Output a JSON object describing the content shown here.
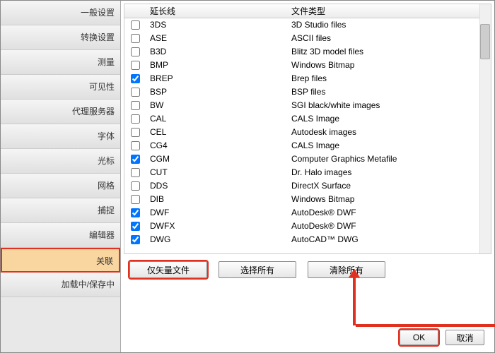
{
  "sidebar": {
    "items": [
      {
        "label": "一般设置"
      },
      {
        "label": "转换设置"
      },
      {
        "label": "测量"
      },
      {
        "label": "可见性"
      },
      {
        "label": "代理服务器"
      },
      {
        "label": "字体"
      },
      {
        "label": "光标"
      },
      {
        "label": "网格"
      },
      {
        "label": "捕捉"
      },
      {
        "label": "编辑器"
      },
      {
        "label": "关联"
      },
      {
        "label": "加载中/保存中"
      }
    ],
    "selected_index": 10
  },
  "table": {
    "headers": {
      "ext": "延长线",
      "type": "文件类型"
    },
    "rows": [
      {
        "checked": false,
        "ext": "3DS",
        "type": "3D Studio files"
      },
      {
        "checked": false,
        "ext": "ASE",
        "type": "ASCII files"
      },
      {
        "checked": false,
        "ext": "B3D",
        "type": "Blitz 3D model files"
      },
      {
        "checked": false,
        "ext": "BMP",
        "type": "Windows Bitmap"
      },
      {
        "checked": true,
        "ext": "BREP",
        "type": "Brep files"
      },
      {
        "checked": false,
        "ext": "BSP",
        "type": "BSP files"
      },
      {
        "checked": false,
        "ext": "BW",
        "type": "SGI black/white images"
      },
      {
        "checked": false,
        "ext": "CAL",
        "type": "CALS Image"
      },
      {
        "checked": false,
        "ext": "CEL",
        "type": "Autodesk images"
      },
      {
        "checked": false,
        "ext": "CG4",
        "type": "CALS Image"
      },
      {
        "checked": true,
        "ext": "CGM",
        "type": "Computer Graphics Metafile"
      },
      {
        "checked": false,
        "ext": "CUT",
        "type": "Dr. Halo images"
      },
      {
        "checked": false,
        "ext": "DDS",
        "type": "DirectX Surface"
      },
      {
        "checked": false,
        "ext": "DIB",
        "type": "Windows Bitmap"
      },
      {
        "checked": true,
        "ext": "DWF",
        "type": "AutoDesk® DWF"
      },
      {
        "checked": true,
        "ext": "DWFX",
        "type": "AutoDesk® DWF"
      },
      {
        "checked": true,
        "ext": "DWG",
        "type": "AutoCAD™ DWG"
      }
    ]
  },
  "buttons": {
    "vector_only": "仅矢量文件",
    "select_all": "选择所有",
    "clear_all": "清除所有",
    "ok": "OK",
    "cancel": "取消"
  }
}
